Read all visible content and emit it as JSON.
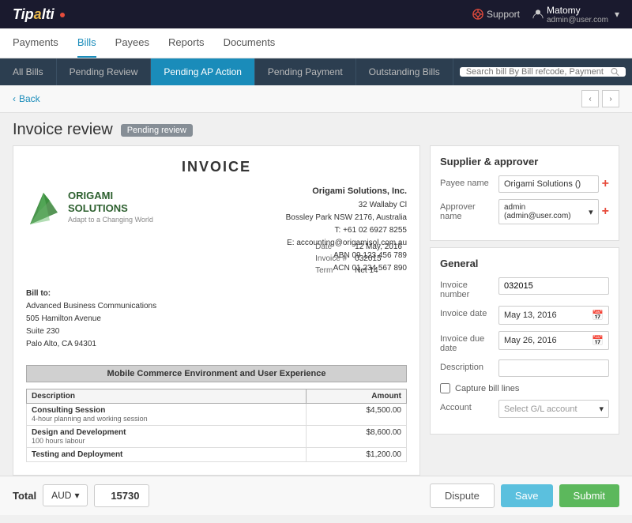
{
  "app": {
    "logo": "Tipalti",
    "logo_dot": "·"
  },
  "topbar": {
    "support_label": "Support",
    "user_name": "Matomy",
    "user_email": "admin@user.com"
  },
  "nav": {
    "items": [
      {
        "label": "Payments"
      },
      {
        "label": "Bills"
      },
      {
        "label": "Payees"
      },
      {
        "label": "Reports"
      },
      {
        "label": "Documents"
      }
    ]
  },
  "subnav": {
    "items": [
      {
        "label": "All Bills",
        "active": false
      },
      {
        "label": "Pending Review",
        "active": false
      },
      {
        "label": "Pending AP Action",
        "active": true
      },
      {
        "label": "Pending Payment",
        "active": false
      },
      {
        "label": "Outstanding Bills",
        "active": false
      }
    ],
    "search_placeholder": "Search bill By Bill refcode, Payment refcode, Payee ID, Name, Company or Alias"
  },
  "breadcrumb": {
    "back_label": "Back"
  },
  "page": {
    "title": "Invoice review",
    "badge": "Pending review"
  },
  "invoice": {
    "title": "INVOICE",
    "supplier_name": "Origami Solutions, Inc.",
    "supplier_address1": "32 Wallaby Cl",
    "supplier_address2": "Bossley Park NSW 2176, Australia",
    "supplier_phone": "T: +61 02 6927 8255",
    "supplier_email": "E: accounting@origamisol.com.au",
    "supplier_abn": "ABN 09 123 456 789",
    "supplier_acn": "ACN 01 234 567 890",
    "company_name": "ORIGAMI",
    "company_name2": "SOLUTIONS",
    "company_tagline": "Adapt to a Changing World",
    "bill_to_title": "Bill to:",
    "bill_to_company": "Advanced Business Communications",
    "bill_to_address1": "505 Hamilton Avenue",
    "bill_to_address2": "Suite 230",
    "bill_to_city": "Palo Alto, CA 94301",
    "meta_date_label": "Date",
    "meta_date": "12 May, 2016",
    "meta_invoice_label": "Invoice #",
    "meta_invoice": "032015",
    "meta_term_label": "Term",
    "meta_term": "Net 14",
    "project_title": "Mobile Commerce Environment and User Experience",
    "table_headers": [
      "Description",
      "Amount"
    ],
    "line_items": [
      {
        "desc": "Consulting Session",
        "sub": "4-hour planning and working session",
        "amount": "$4,500.00"
      },
      {
        "desc": "Design and Development",
        "sub": "100 hours labour",
        "amount": "$8,600.00"
      },
      {
        "desc": "Testing and Deployment",
        "sub": "",
        "amount": "$1,200.00"
      }
    ]
  },
  "supplier_panel": {
    "title": "Supplier & approver",
    "payee_label": "Payee name",
    "payee_value": "Origami Solutions ()",
    "approver_label": "Approver name",
    "approver_value": "admin (admin@user.com)"
  },
  "general_panel": {
    "title": "General",
    "invoice_number_label": "Invoice number",
    "invoice_number": "032015",
    "invoice_date_label": "Invoice date",
    "invoice_date": "May 13, 2016",
    "invoice_due_label": "Invoice due date",
    "invoice_due": "May 26, 2016",
    "description_label": "Description",
    "capture_label": "Capture bill lines",
    "account_label": "Account",
    "account_placeholder": "Select G/L account"
  },
  "bottom": {
    "total_label": "Total",
    "currency": "AUD",
    "amount": "15730",
    "dispute_label": "Dispute",
    "save_label": "Save",
    "submit_label": "Submit"
  }
}
